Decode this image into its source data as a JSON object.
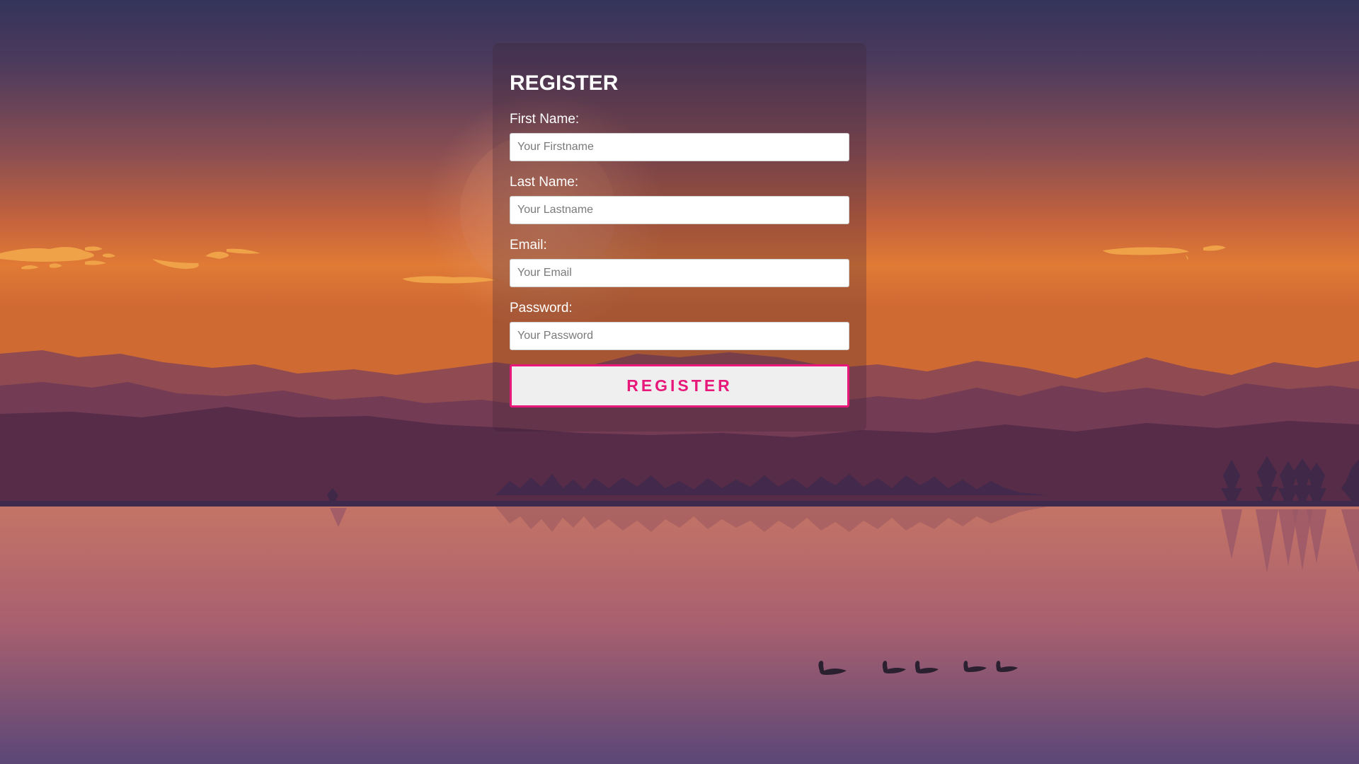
{
  "form": {
    "title": "REGISTER",
    "fields": [
      {
        "label": "First Name:",
        "placeholder": "Your Firstname",
        "value": ""
      },
      {
        "label": "Last Name:",
        "placeholder": "Your Lastname",
        "value": ""
      },
      {
        "label": "Email:",
        "placeholder": "Your Email",
        "value": ""
      },
      {
        "label": "Password:",
        "placeholder": "Your Password",
        "value": ""
      }
    ],
    "submit_label": "REGISTER"
  },
  "colors": {
    "accent": "#e8177a",
    "button_bg": "#efefef",
    "label_text": "#ffffff"
  }
}
